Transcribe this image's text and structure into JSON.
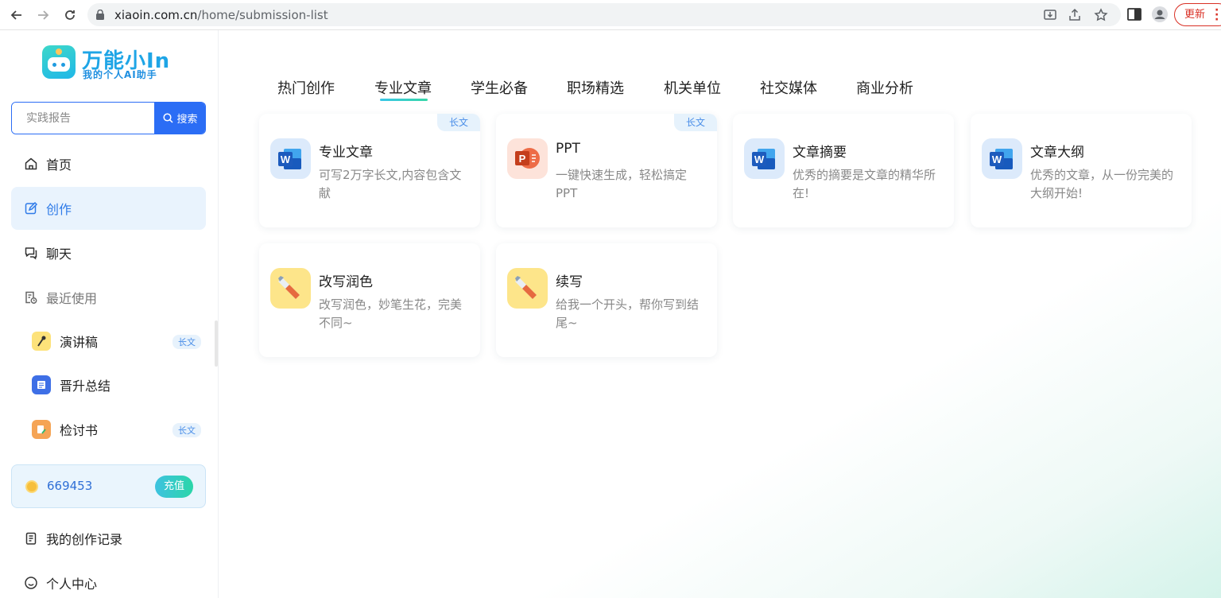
{
  "browser": {
    "url_host": "xiaoin.com.cn",
    "url_path": "/home/submission-list",
    "update_label": "更新"
  },
  "sidebar": {
    "logo_title": "万能小In",
    "logo_subtitle": "我的个人AI助手",
    "search": {
      "placeholder": "实践报告",
      "button_label": "搜索"
    },
    "menu": [
      {
        "label": "首页",
        "icon": "home-icon"
      },
      {
        "label": "创作",
        "icon": "edit-icon"
      },
      {
        "label": "聊天",
        "icon": "chat-icon"
      },
      {
        "label": "最近使用",
        "icon": "recent-icon"
      }
    ],
    "recent": [
      {
        "label": "演讲稿",
        "badge": "长文",
        "icon": "microphone-icon"
      },
      {
        "label": "晋升总结",
        "badge": "",
        "icon": "book-icon"
      },
      {
        "label": "检讨书",
        "badge": "长文",
        "icon": "document-pen-icon"
      }
    ],
    "coins": {
      "value": "669453",
      "recharge_label": "充值"
    },
    "bottom": [
      {
        "label": "我的创作记录",
        "icon": "record-icon"
      },
      {
        "label": "个人中心",
        "icon": "user-center-icon"
      }
    ]
  },
  "tabs": [
    "热门创作",
    "专业文章",
    "学生必备",
    "职场精选",
    "机关单位",
    "社交媒体",
    "商业分析"
  ],
  "active_tab": "专业文章",
  "cards": [
    {
      "title": "专业文章",
      "desc": "可写2万字长文,内容包含文献",
      "badge": "长文",
      "icon": "word-icon"
    },
    {
      "title": "PPT",
      "desc": "一键快速生成，轻松搞定PPT",
      "badge": "长文",
      "icon": "ppt-icon"
    },
    {
      "title": "文章摘要",
      "desc": "优秀的摘要是文章的精华所在!",
      "badge": "",
      "icon": "word-icon"
    },
    {
      "title": "文章大纲",
      "desc": "优秀的文章，从一份完美的大纲开始!",
      "badge": "",
      "icon": "word-icon"
    },
    {
      "title": "改写润色",
      "desc": "改写润色，妙笔生花，完美不同~",
      "badge": "",
      "icon": "pen-icon"
    },
    {
      "title": "续写",
      "desc": "给我一个开头，帮你写到结尾~",
      "badge": "",
      "icon": "pen-icon"
    }
  ],
  "colors": {
    "accent": "#2b6df5",
    "active_bg": "#e9f3fd",
    "badge_text": "#4a8ee8",
    "teal": "#37d7a7"
  }
}
